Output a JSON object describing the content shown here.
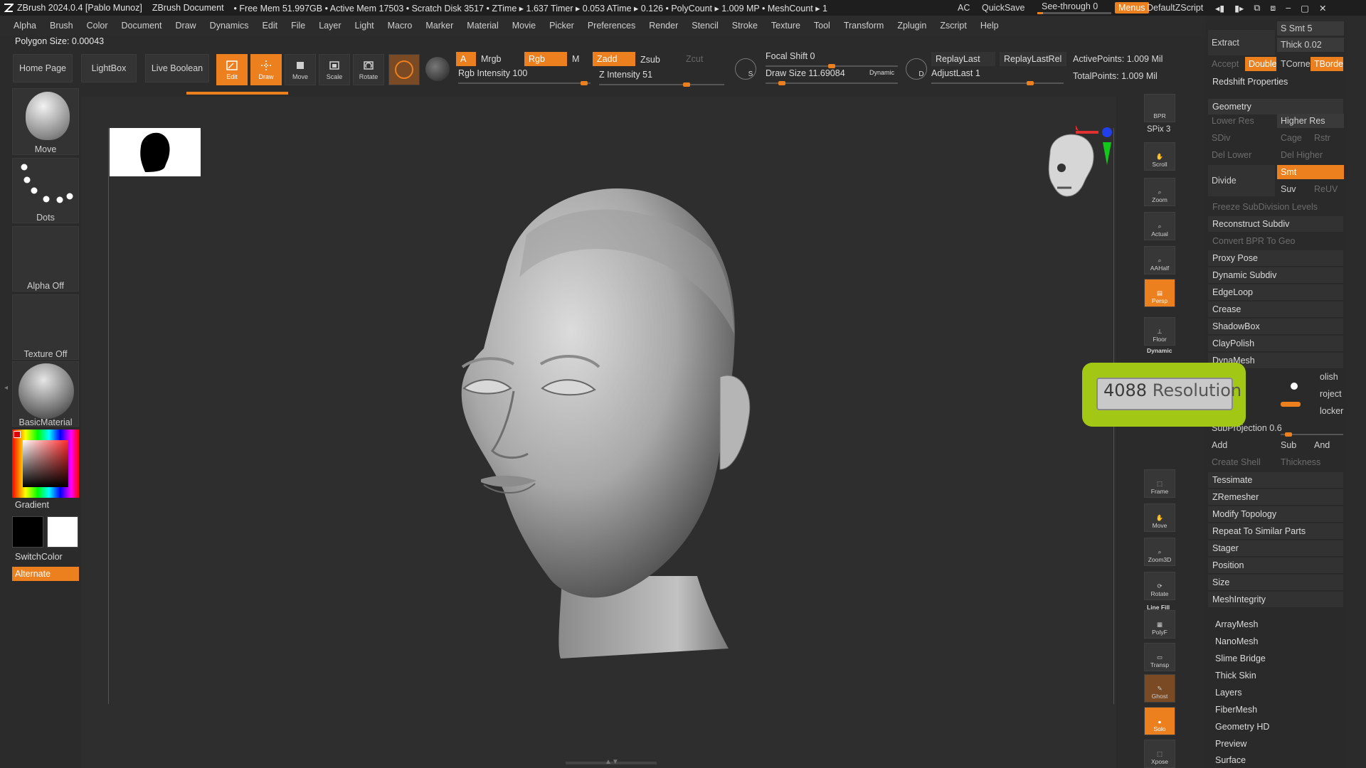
{
  "titlebar": {
    "app": "ZBrush 2024.0.4 [Pablo Munoz]",
    "document": "ZBrush Document",
    "stats": "• Free Mem 51.997GB • Active Mem 17503 • Scratch Disk 3517 • ZTime ▸ 1.637 Timer ▸ 0.053 ATime ▸ 0.126 • PolyCount ▸ 1.009 MP • MeshCount ▸ 1",
    "ac": "AC",
    "quicksave": "QuickSave",
    "see_through": "See-through  0",
    "menus": "Menus",
    "script": "DefaultZScript"
  },
  "menubar": [
    "Alpha",
    "Brush",
    "Color",
    "Document",
    "Draw",
    "Dynamics",
    "Edit",
    "File",
    "Layer",
    "Light",
    "Macro",
    "Marker",
    "Material",
    "Movie",
    "Picker",
    "Preferences",
    "Render",
    "Stencil",
    "Stroke",
    "Texture",
    "Tool",
    "Transform",
    "Zplugin",
    "Zscript",
    "Help"
  ],
  "polygon_size": "Polygon Size: 0.00043",
  "nav": {
    "home": "Home Page",
    "lightbox": "LightBox",
    "live_boolean": "Live Boolean"
  },
  "tools": {
    "edit": "Edit",
    "draw": "Draw",
    "move": "Move",
    "scale": "Scale",
    "rotate": "Rotate"
  },
  "draw_controls": {
    "a": "A",
    "mrgb": "Mrgb",
    "rgb": "Rgb",
    "m": "M",
    "zadd": "Zadd",
    "zsub": "Zsub",
    "zcut": "Zcut",
    "rgb_intensity": "Rgb Intensity 100",
    "z_intensity": "Z Intensity 51",
    "focal_shift": "Focal Shift 0",
    "draw_size": "Draw Size 11.69084",
    "dynamic": "Dynamic",
    "replay_last": "ReplayLast",
    "replay_last_rel": "ReplayLastRel",
    "adjust_last": "AdjustLast 1",
    "active_points": "ActivePoints: 1.009 Mil",
    "total_points": "TotalPoints: 1.009 Mil",
    "s_label": "S",
    "d_label": "D"
  },
  "left_shelf": {
    "brush": "Move",
    "stroke": "Dots",
    "alpha": "Alpha Off",
    "texture": "Texture Off",
    "material": "BasicMaterial",
    "gradient": "Gradient",
    "switch_color": "SwitchColor",
    "alternate": "Alternate"
  },
  "right_strip": [
    "BPR",
    "SPix 3",
    "Scroll",
    "Zoom",
    "Actual",
    "AAHalf",
    "Persp",
    "Floor",
    "Dynamic",
    "Frame",
    "Move",
    "Zoom3D",
    "Rotate",
    "Line Fill",
    "PolyF",
    "Transp",
    "Ghost",
    "Solo",
    "Xpose"
  ],
  "right_panel": {
    "extract": "Extract",
    "s_smt": "S Smt 5",
    "thick": "Thick 0.02",
    "accept": "Accept",
    "double": "Double",
    "tcorne": "TCorne",
    "tborde": "TBorde",
    "redshift": "Redshift Properties",
    "geometry": "Geometry",
    "lower_res": "Lower Res",
    "higher_res": "Higher Res",
    "sdiv": "SDiv",
    "cage": "Cage",
    "rstr": "Rstr",
    "del_lower": "Del Lower",
    "del_higher": "Del Higher",
    "divide": "Divide",
    "smt": "Smt",
    "suv": "Suv",
    "reuv": "ReUV",
    "freeze": "Freeze SubDivision Levels",
    "reconstruct": "Reconstruct Subdiv",
    "convert_bpr": "Convert BPR To Geo",
    "items_a": [
      "Proxy Pose",
      "Dynamic Subdiv",
      "EdgeLoop",
      "Crease",
      "ShadowBox",
      "ClayPolish",
      "DynaMesh"
    ],
    "polish": "olish",
    "project": "roject",
    "blocker": "locker",
    "subprojection": "SubProjection 0.6",
    "add": "Add",
    "sub": "Sub",
    "and": "And",
    "create_shell": "Create Shell",
    "thickness": "Thickness",
    "items_b": [
      "Tessimate",
      "ZRemesher",
      "Modify Topology",
      "Repeat To Similar Parts",
      "Stager",
      "Position",
      "Size",
      "MeshIntegrity"
    ],
    "items_c": [
      "ArrayMesh",
      "NanoMesh",
      "Slime Bridge",
      "Thick Skin",
      "Layers",
      "FiberMesh",
      "Geometry HD",
      "Preview",
      "Surface"
    ]
  },
  "resolution_popup": {
    "value": "4088",
    "label": "Resolution"
  },
  "colors": {
    "accent": "#ec7f1e",
    "highlight": "#a2c815",
    "background": "#2b2b2b"
  }
}
